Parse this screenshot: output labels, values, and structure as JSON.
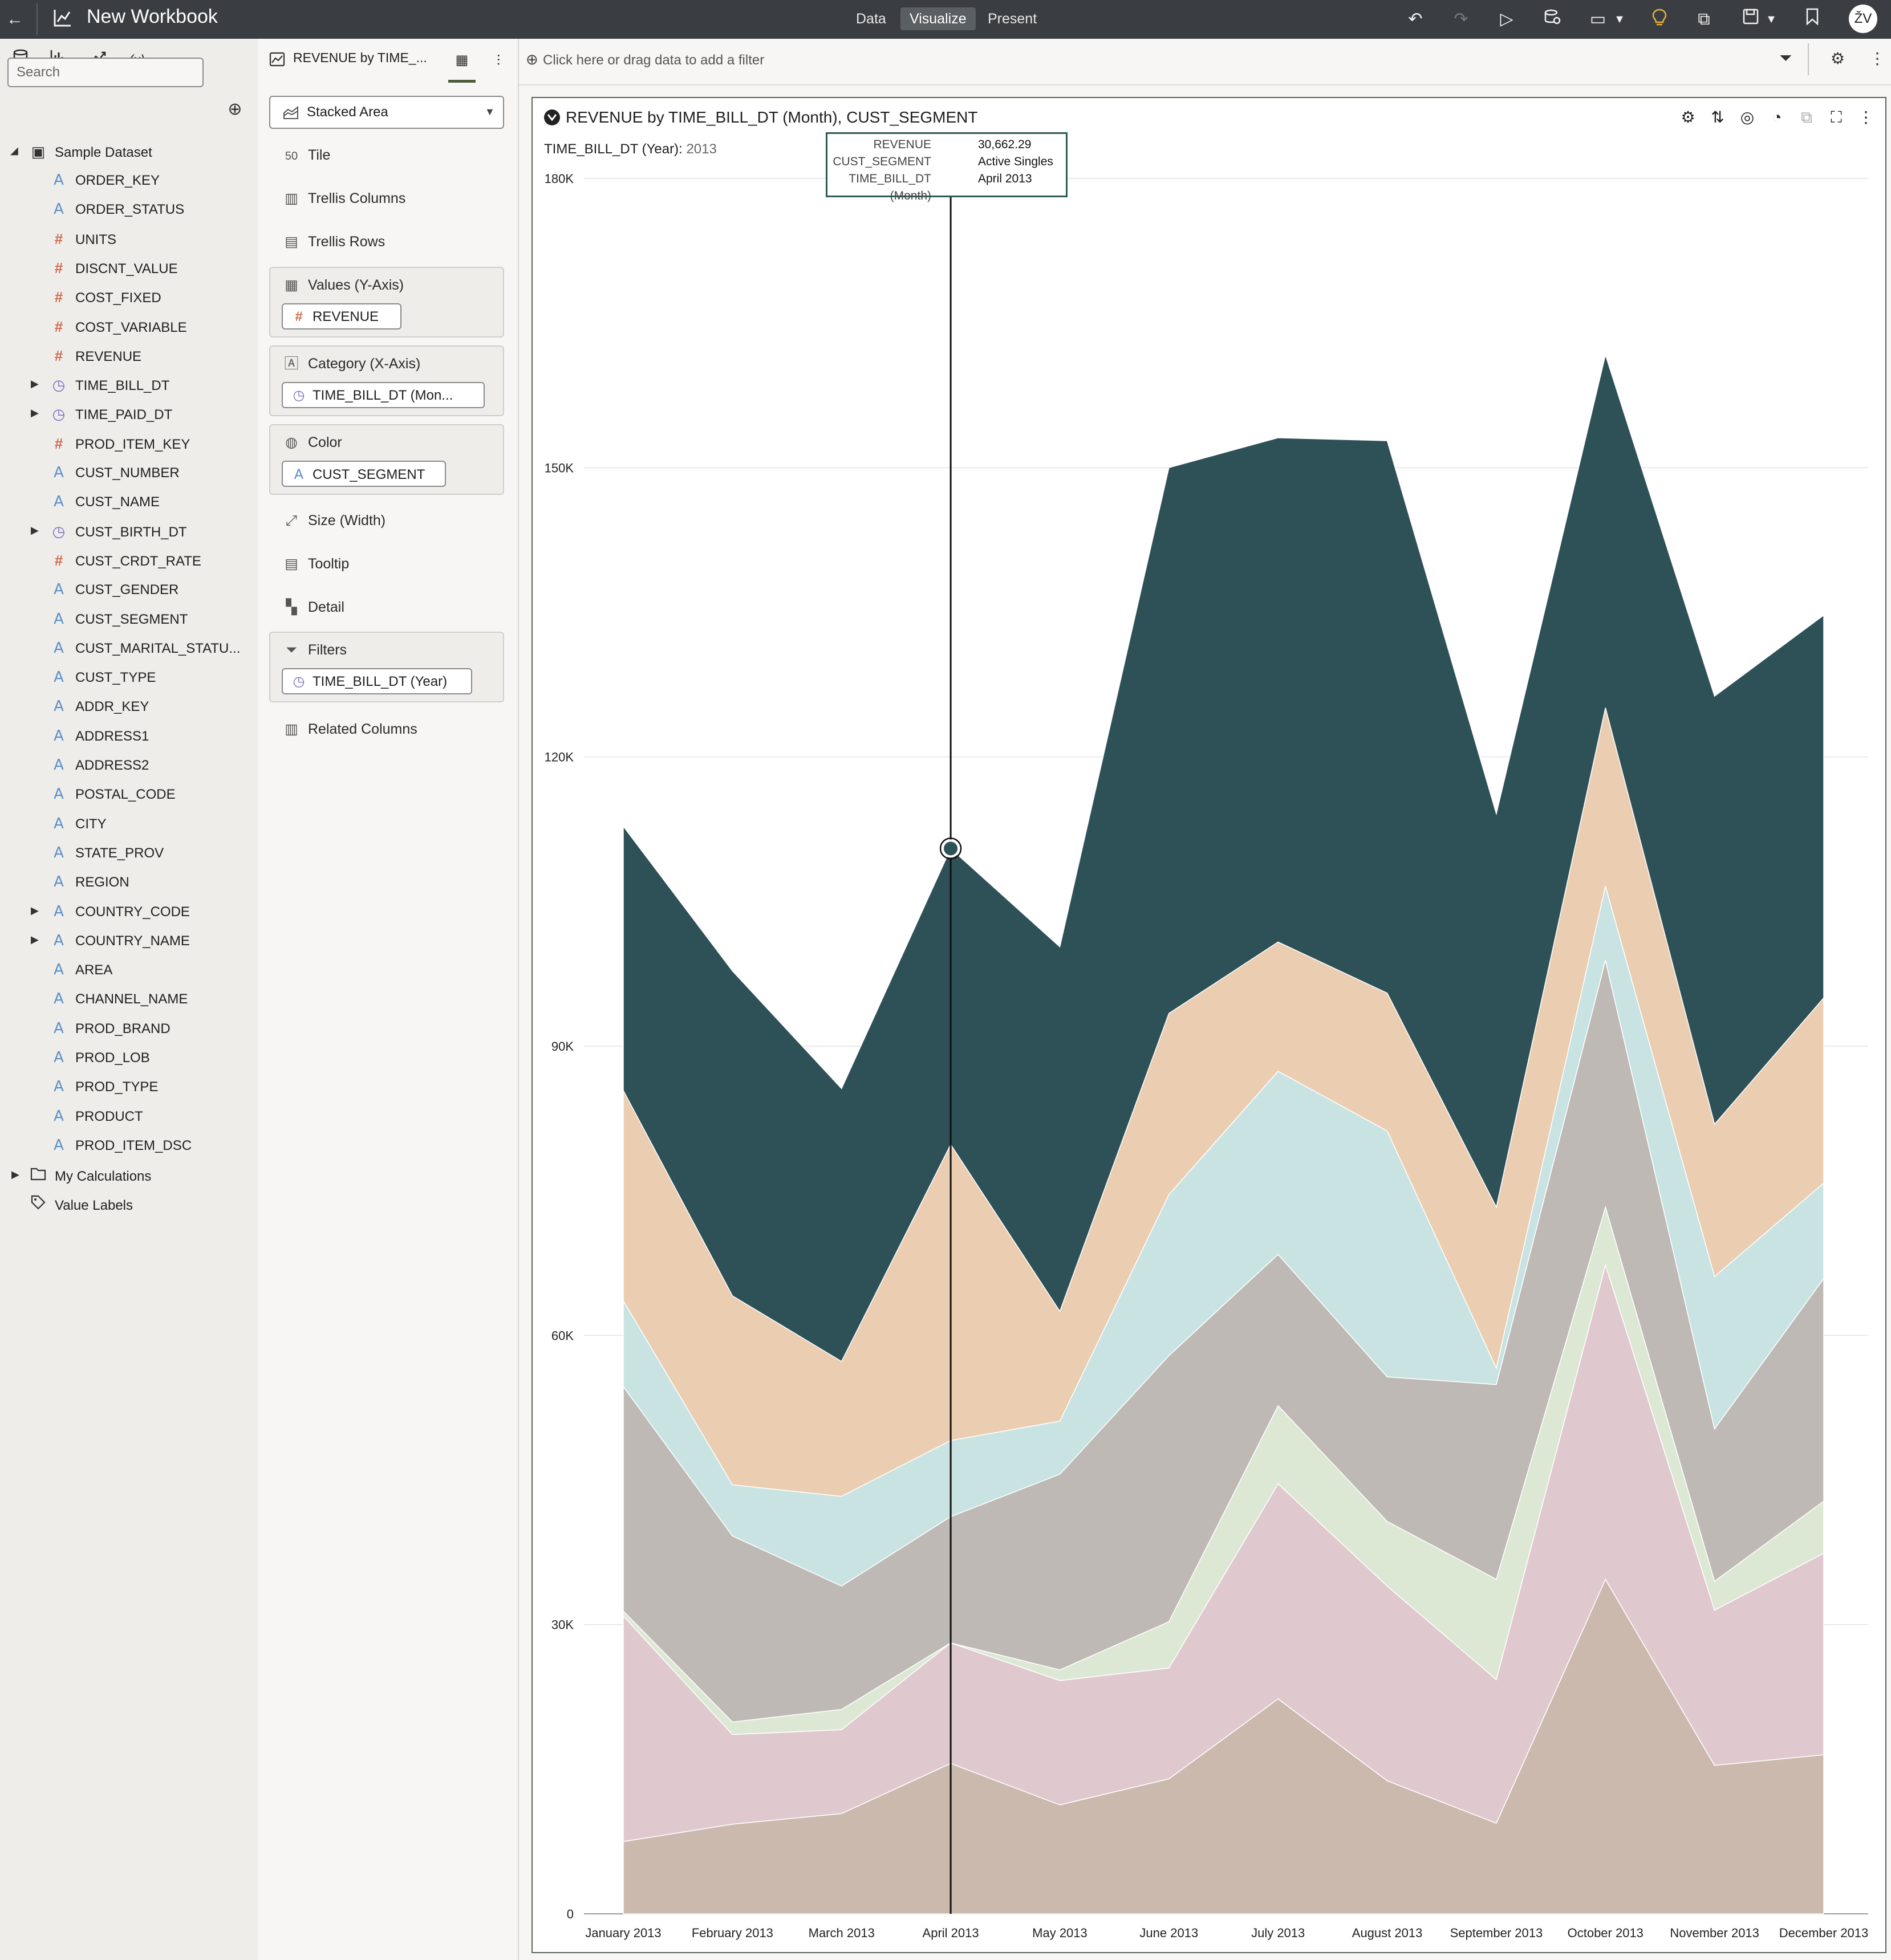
{
  "topbar": {
    "title": "New Workbook",
    "nav": [
      "Data",
      "Visualize",
      "Present"
    ],
    "active_nav": "Visualize",
    "user_initials": "ŽV"
  },
  "left_panel": {
    "search_placeholder": "Search",
    "dataset_name": "Sample Dataset",
    "columns": [
      {
        "name": "ORDER_KEY",
        "type": "A"
      },
      {
        "name": "ORDER_STATUS",
        "type": "A"
      },
      {
        "name": "UNITS",
        "type": "#"
      },
      {
        "name": "DISCNT_VALUE",
        "type": "#"
      },
      {
        "name": "COST_FIXED",
        "type": "#"
      },
      {
        "name": "COST_VARIABLE",
        "type": "#"
      },
      {
        "name": "REVENUE",
        "type": "#"
      },
      {
        "name": "TIME_BILL_DT",
        "type": "time",
        "expandable": true
      },
      {
        "name": "TIME_PAID_DT",
        "type": "time",
        "expandable": true
      },
      {
        "name": "PROD_ITEM_KEY",
        "type": "#"
      },
      {
        "name": "CUST_NUMBER",
        "type": "A"
      },
      {
        "name": "CUST_NAME",
        "type": "A"
      },
      {
        "name": "CUST_BIRTH_DT",
        "type": "time",
        "expandable": true
      },
      {
        "name": "CUST_CRDT_RATE",
        "type": "#"
      },
      {
        "name": "CUST_GENDER",
        "type": "A"
      },
      {
        "name": "CUST_SEGMENT",
        "type": "A"
      },
      {
        "name": "CUST_MARITAL_STATU...",
        "type": "A"
      },
      {
        "name": "CUST_TYPE",
        "type": "A"
      },
      {
        "name": "ADDR_KEY",
        "type": "A"
      },
      {
        "name": "ADDRESS1",
        "type": "A"
      },
      {
        "name": "ADDRESS2",
        "type": "A"
      },
      {
        "name": "POSTAL_CODE",
        "type": "A"
      },
      {
        "name": "CITY",
        "type": "A"
      },
      {
        "name": "STATE_PROV",
        "type": "A"
      },
      {
        "name": "REGION",
        "type": "A"
      },
      {
        "name": "COUNTRY_CODE",
        "type": "A",
        "expandable": true
      },
      {
        "name": "COUNTRY_NAME",
        "type": "A",
        "expandable": true
      },
      {
        "name": "AREA",
        "type": "A"
      },
      {
        "name": "CHANNEL_NAME",
        "type": "A"
      },
      {
        "name": "PROD_BRAND",
        "type": "A"
      },
      {
        "name": "PROD_LOB",
        "type": "A"
      },
      {
        "name": "PROD_TYPE",
        "type": "A"
      },
      {
        "name": "PRODUCT",
        "type": "A"
      },
      {
        "name": "PROD_ITEM_DSC",
        "type": "A"
      }
    ],
    "my_calculations": "My Calculations",
    "value_labels": "Value Labels"
  },
  "middle_panel": {
    "viz_tab_title": "REVENUE by TIME_...",
    "chart_type": "Stacked Area",
    "tile": "Tile",
    "trellis_columns": "Trellis Columns",
    "trellis_rows": "Trellis Rows",
    "values_label": "Values (Y-Axis)",
    "values_pill": "REVENUE",
    "category_label": "Category (X-Axis)",
    "category_pill": "TIME_BILL_DT (Mon...",
    "color_label": "Color",
    "color_pill": "CUST_SEGMENT",
    "size_label": "Size (Width)",
    "tooltip_label": "Tooltip",
    "detail_label": "Detail",
    "filters_label": "Filters",
    "filters_pill": "TIME_BILL_DT (Year)",
    "related_columns": "Related Columns"
  },
  "filter_bar": {
    "placeholder": "Click here or drag data to add a filter"
  },
  "tooltip": {
    "rows": [
      {
        "key": "REVENUE",
        "value": "30,662.29"
      },
      {
        "key": "CUST_SEGMENT",
        "value": "Active Singles"
      },
      {
        "key": "TIME_BILL_DT (Month)",
        "value": "April 2013"
      }
    ]
  },
  "chart_data": {
    "type": "area",
    "stacked": true,
    "title": "REVENUE by TIME_BILL_DT (Month), CUST_SEGMENT",
    "trellis_label": "TIME_BILL_DT (Year):",
    "trellis_value": "2013",
    "categories": [
      "January 2013",
      "February 2013",
      "March 2013",
      "April 2013",
      "May 2013",
      "June 2013",
      "July 2013",
      "August 2013",
      "September 2013",
      "October 2013",
      "November 2013",
      "December 2013"
    ],
    "ylim": [
      0,
      180000
    ],
    "yticks": [
      "0",
      "30K",
      "60K",
      "90K",
      "120K",
      "150K",
      "180K"
    ],
    "ytick_values": [
      0,
      30000,
      60000,
      90000,
      120000,
      150000,
      180000
    ],
    "grid": true,
    "highlight_category": "April 2013",
    "series": [
      {
        "color": "#cbb9ae",
        "values": [
          7500,
          9300,
          10400,
          15600,
          11300,
          14000,
          22300,
          13800,
          9400,
          34700,
          15400,
          16500
        ]
      },
      {
        "color": "#e0c8cf",
        "values": [
          23400,
          9300,
          8700,
          12500,
          12900,
          11500,
          22300,
          20200,
          14900,
          32600,
          16100,
          20900
        ]
      },
      {
        "color": "#dce8d4",
        "values": [
          500,
          1300,
          2100,
          0,
          1100,
          4800,
          8100,
          6700,
          10400,
          6000,
          3000,
          5400
        ]
      },
      {
        "color": "#beb9b5",
        "values": [
          23300,
          19300,
          12800,
          13100,
          20300,
          27600,
          15700,
          15000,
          20200,
          25600,
          15800,
          23100
        ]
      },
      {
        "color": "#c9e3e3",
        "values": [
          8900,
          5300,
          9300,
          7900,
          5500,
          16700,
          19000,
          25500,
          1700,
          7700,
          15800,
          9900
        ]
      },
      {
        "color": "#ebcdb1",
        "values": [
          21800,
          19600,
          14000,
          30700,
          11400,
          18800,
          13400,
          14300,
          16700,
          18500,
          15800,
          19200
        ]
      },
      {
        "color": "#2e5057",
        "values": [
          27400,
          33700,
          28300,
          30700,
          37800,
          56600,
          52300,
          57300,
          40800,
          36600,
          44400,
          39700
        ]
      }
    ]
  }
}
